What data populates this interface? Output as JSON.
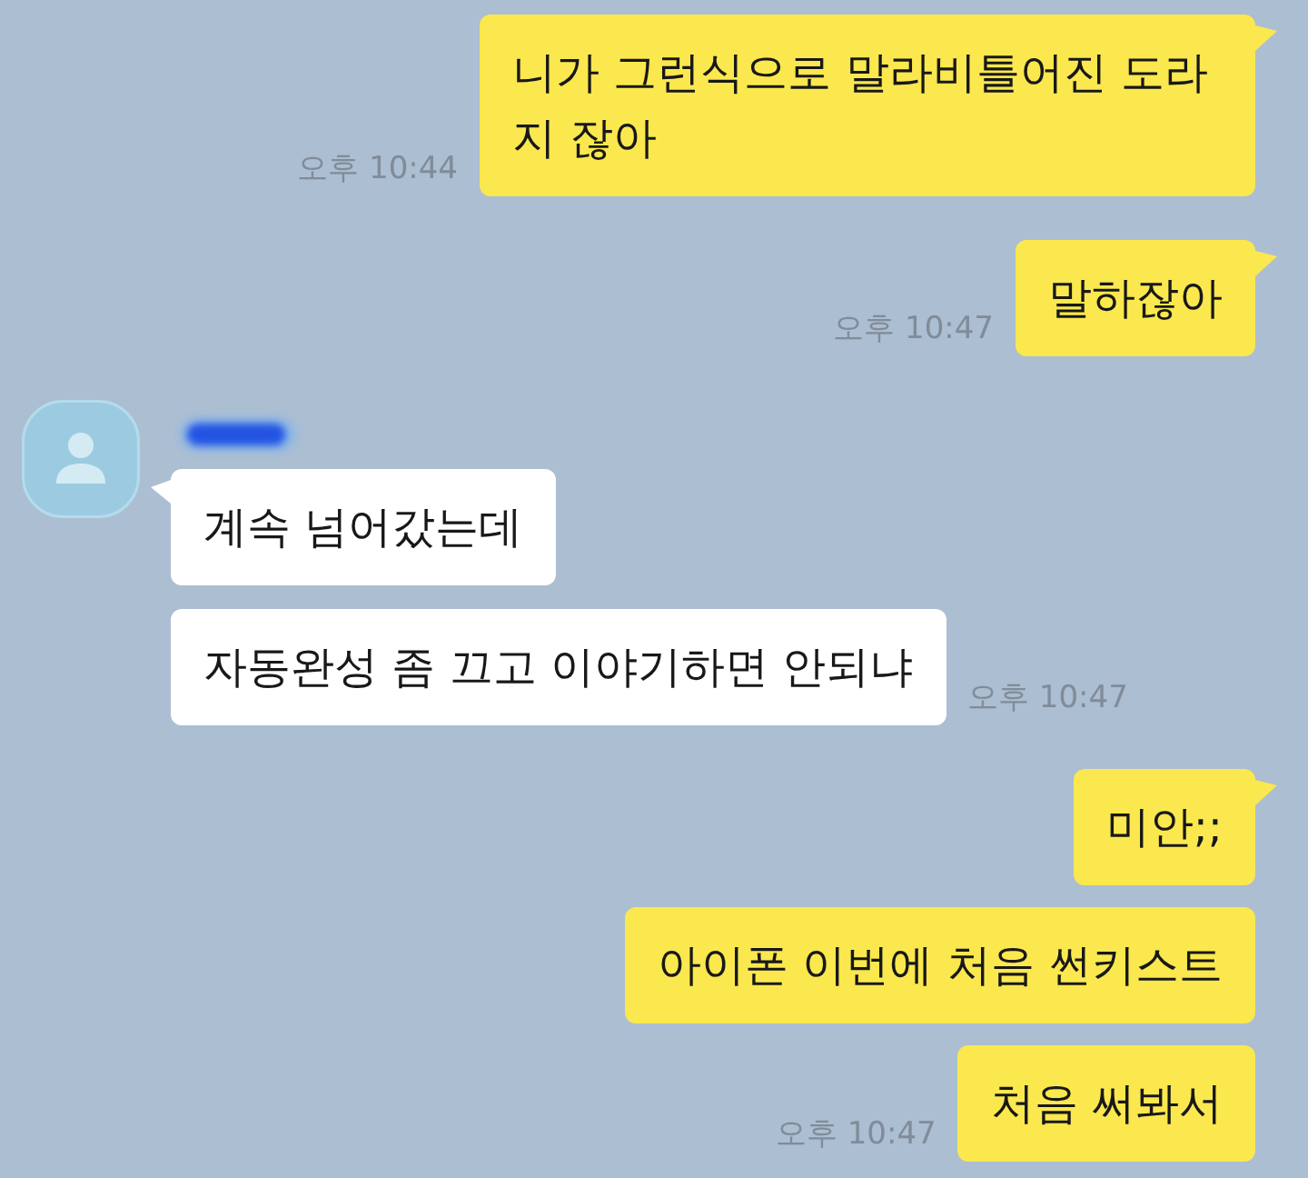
{
  "chat": [
    {
      "kind": "sent",
      "time": "오후 10:44",
      "messages": [
        "니가 그런식으로 말라비틀어진 도라지 잖아"
      ]
    },
    {
      "kind": "sent",
      "time": "오후 10:47",
      "messages": [
        "말하잖아"
      ]
    },
    {
      "kind": "received",
      "name_redacted": true,
      "time": "오후 10:47",
      "messages": [
        "계속 넘어갔는데",
        "자동완성 좀 끄고 이야기하면 안되냐"
      ]
    },
    {
      "kind": "sent",
      "time": "오후 10:47",
      "messages": [
        "미안;;",
        "아이폰 이번에 처음 썬키스트",
        "처음 써봐서"
      ]
    }
  ]
}
